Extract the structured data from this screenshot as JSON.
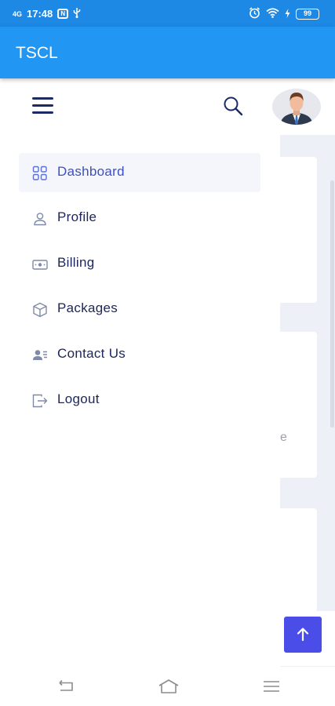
{
  "status_bar": {
    "signal": "4G",
    "time": "17:48",
    "notification_badge": "N",
    "battery": "99"
  },
  "app_bar": {
    "title": "TSCL"
  },
  "drawer": {
    "items": [
      {
        "label": "Dashboard",
        "icon": "dashboard-grid-icon",
        "active": true
      },
      {
        "label": "Profile",
        "icon": "user-icon",
        "active": false
      },
      {
        "label": "Billing",
        "icon": "billing-card-icon",
        "active": false
      },
      {
        "label": "Packages",
        "icon": "package-box-icon",
        "active": false
      },
      {
        "label": "Contact Us",
        "icon": "contact-icon",
        "active": false
      },
      {
        "label": "Logout",
        "icon": "logout-icon",
        "active": false
      }
    ]
  },
  "background": {
    "partial_text": "e"
  },
  "colors": {
    "status_bar": "#1e88e5",
    "app_bar": "#2196f3",
    "drawer_text": "#1b2559",
    "active_text": "#3d4fc4",
    "icon": "#7f8aa6",
    "scroll_top_button": "#4a4de8"
  }
}
